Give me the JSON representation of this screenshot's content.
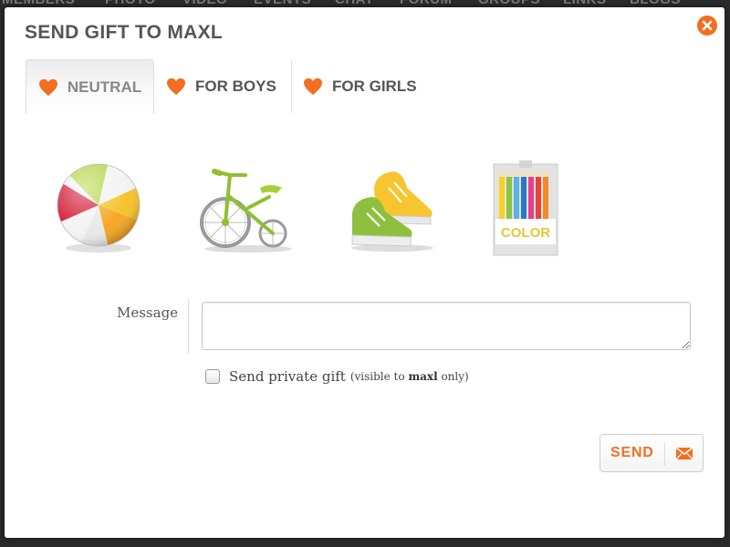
{
  "background_nav": {
    "items": [
      "MEMBERS",
      "PHOTO",
      "VIDEO",
      "EVENTS",
      "CHAT",
      "FORUM",
      "GROUPS",
      "LINKS",
      "BLOGS"
    ]
  },
  "modal": {
    "title": "SEND GIFT TO MAXL",
    "close_icon": "close-circle-icon",
    "accent_color": "#f26f21"
  },
  "tabs": [
    {
      "label": "NEUTRAL",
      "icon": "heart-icon",
      "active": true
    },
    {
      "label": "FOR BOYS",
      "icon": "heart-icon",
      "active": false
    },
    {
      "label": "FOR GIRLS",
      "icon": "heart-icon",
      "active": false
    }
  ],
  "gifts": [
    {
      "name": "beach-ball",
      "icon": "beach-ball-icon"
    },
    {
      "name": "tricycle",
      "icon": "tricycle-icon"
    },
    {
      "name": "sneakers",
      "icon": "sneakers-icon"
    },
    {
      "name": "color-pencils",
      "icon": "color-pencils-icon",
      "box_text": "COLOR"
    }
  ],
  "form": {
    "message_label": "Message",
    "message_value": "",
    "private_label": "Send private gift",
    "private_checked": false,
    "private_note_prefix": "(visible to",
    "private_note_user": "maxl",
    "private_note_suffix": "only)"
  },
  "send_button": {
    "label": "SEND",
    "icon": "envelope-icon"
  }
}
